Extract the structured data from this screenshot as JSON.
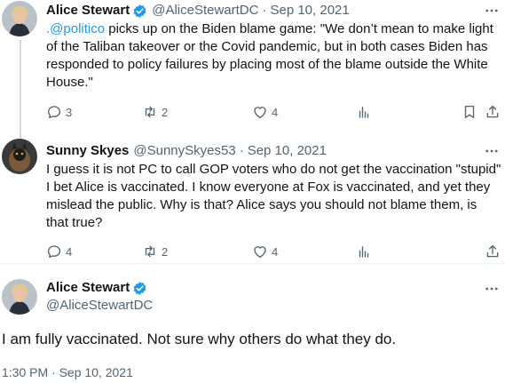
{
  "tweets": [
    {
      "name": "Alice Stewart",
      "handle": "@AliceStewartDC",
      "dot": "·",
      "date": "Sep 10, 2021",
      "mention": ".@politico",
      "text": " picks up on the Biden blame game: \"We don’t mean to make light of the Taliban takeover or the Covid pandemic, but in both cases Biden has responded to policy failures by placing most of the blame outside the White House.\"",
      "replies": "3",
      "retweets": "2",
      "likes": "4",
      "verified": true
    },
    {
      "name": "Sunny Skyes",
      "handle": "@SunnySkyes53",
      "dot": "·",
      "date": "Sep 10, 2021",
      "text": "I guess it is not PC to call GOP voters who do not get the vaccination \"stupid\" I bet Alice is vaccinated. I know everyone at Fox is vaccinated, and yet they mislead the public. Why is that? Alice says you should not blame them, is that true?",
      "replies": "4",
      "retweets": "2",
      "likes": "4",
      "verified": false
    }
  ],
  "main": {
    "name": "Alice Stewart",
    "handle": "@AliceStewartDC",
    "text": "I am fully vaccinated. Not sure why others do what they do.",
    "timestamp": "1:30 PM · Sep 10, 2021",
    "verified": true
  },
  "colors": {
    "accent": "#1d9bf0",
    "text": "#0f1419",
    "muted": "#536471",
    "divider": "#eff3f4"
  },
  "icons": [
    "verified-badge-icon",
    "more-icon",
    "reply-icon",
    "retweet-icon",
    "like-icon",
    "analytics-icon",
    "bookmark-icon",
    "share-icon"
  ]
}
